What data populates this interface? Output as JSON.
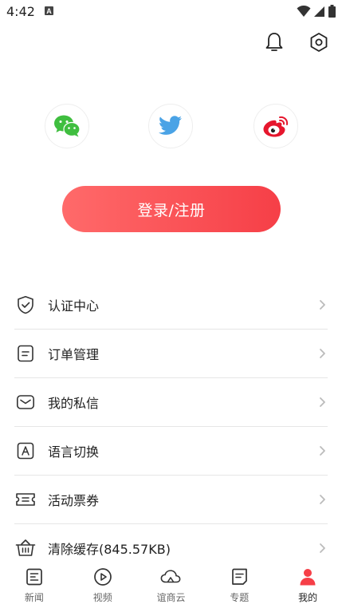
{
  "status_bar": {
    "time": "4:42",
    "a_icon_letter": "A"
  },
  "top_actions": [
    {
      "name": "bell-icon"
    },
    {
      "name": "settings-hex-icon"
    }
  ],
  "social_login": [
    {
      "name": "wechat-icon",
      "color": "#3fbe3f"
    },
    {
      "name": "twitter-icon",
      "color": "#4aa3e6"
    },
    {
      "name": "weibo-icon",
      "color": "#e6162d"
    }
  ],
  "login_button": {
    "label": "登录/注册",
    "gradient_start": "#ff6a6a",
    "gradient_end": "#f63f47"
  },
  "menu": {
    "items": [
      {
        "label": "认证中心",
        "icon": "shield-check-icon"
      },
      {
        "label": "订单管理",
        "icon": "order-doc-icon"
      },
      {
        "label": "我的私信",
        "icon": "mail-icon"
      },
      {
        "label": "语言切换",
        "icon": "language-icon"
      },
      {
        "label": "活动票券",
        "icon": "ticket-icon"
      },
      {
        "label": "清除缓存(845.57KB)",
        "icon": "basket-icon"
      }
    ]
  },
  "bottom_nav": {
    "items": [
      {
        "label": "新闻",
        "icon": "news-icon"
      },
      {
        "label": "视频",
        "icon": "video-icon"
      },
      {
        "label": "谊商云",
        "icon": "cloud-icon"
      },
      {
        "label": "专题",
        "icon": "topic-icon"
      },
      {
        "label": "我的",
        "icon": "profile-icon",
        "active": true
      }
    ],
    "active_color": "#f63f47"
  }
}
